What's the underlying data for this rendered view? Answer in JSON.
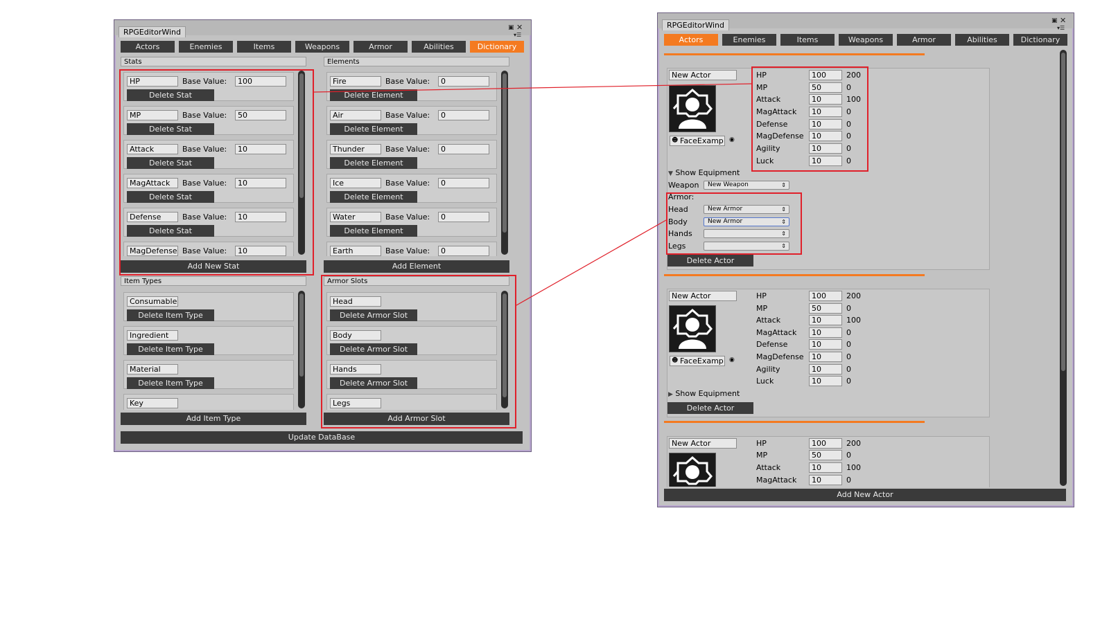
{
  "left": {
    "title": "RPGEditorWind",
    "tabs": [
      "Actors",
      "Enemies",
      "Items",
      "Weapons",
      "Armor",
      "Abilities",
      "Dictionary"
    ],
    "active_tab": "Dictionary",
    "stats": {
      "header": "Stats",
      "base_label": "Base Value:",
      "delete_label": "Delete Stat",
      "items": [
        {
          "name": "HP",
          "value": "100"
        },
        {
          "name": "MP",
          "value": "50"
        },
        {
          "name": "Attack",
          "value": "10"
        },
        {
          "name": "MagAttack",
          "value": "10"
        },
        {
          "name": "Defense",
          "value": "10"
        },
        {
          "name": "MagDefense",
          "value": "10"
        }
      ],
      "add_label": "Add New Stat"
    },
    "elements": {
      "header": "Elements",
      "base_label": "Base Value:",
      "delete_label": "Delete Element",
      "items": [
        {
          "name": "Fire",
          "value": "0"
        },
        {
          "name": "Air",
          "value": "0"
        },
        {
          "name": "Thunder",
          "value": "0"
        },
        {
          "name": "Ice",
          "value": "0"
        },
        {
          "name": "Water",
          "value": "0"
        },
        {
          "name": "Earth",
          "value": "0"
        }
      ],
      "add_label": "Add Element"
    },
    "item_types": {
      "header": "Item Types",
      "delete_label": "Delete Item Type",
      "items": [
        "Consumable",
        "Ingredient",
        "Material",
        "Key"
      ],
      "add_label": "Add Item Type"
    },
    "armor_slots": {
      "header": "Armor Slots",
      "delete_label": "Delete Armor Slot",
      "items": [
        "Head",
        "Body",
        "Hands",
        "Legs"
      ],
      "add_label": "Add Armor Slot"
    },
    "update_label": "Update DataBase"
  },
  "right": {
    "title": "RPGEditorWind",
    "tabs": [
      "Actors",
      "Enemies",
      "Items",
      "Weapons",
      "Armor",
      "Abilities",
      "Dictionary"
    ],
    "active_tab": "Actors",
    "actors": [
      {
        "name": "New Actor",
        "face": "FaceExamp",
        "stats": [
          {
            "name": "HP",
            "value": "100",
            "max": "200"
          },
          {
            "name": "MP",
            "value": "50",
            "max": "0"
          },
          {
            "name": "Attack",
            "value": "10",
            "max": "100"
          },
          {
            "name": "MagAttack",
            "value": "10",
            "max": "0"
          },
          {
            "name": "Defense",
            "value": "10",
            "max": "0"
          },
          {
            "name": "MagDefense",
            "value": "10",
            "max": "0"
          },
          {
            "name": "Agility",
            "value": "10",
            "max": "0"
          },
          {
            "name": "Luck",
            "value": "10",
            "max": "0"
          }
        ],
        "equipment_toggle": "Show Equipment",
        "weapon_label": "Weapon",
        "weapon_value": "New Weapon",
        "armor_label": "Armor:",
        "armor": [
          {
            "slot": "Head",
            "value": "New Armor"
          },
          {
            "slot": "Body",
            "value": "New Armor"
          },
          {
            "slot": "Hands",
            "value": ""
          },
          {
            "slot": "Legs",
            "value": ""
          }
        ],
        "delete_label": "Delete Actor"
      },
      {
        "name": "New Actor",
        "face": "FaceExamp",
        "stats": [
          {
            "name": "HP",
            "value": "100",
            "max": "200"
          },
          {
            "name": "MP",
            "value": "50",
            "max": "0"
          },
          {
            "name": "Attack",
            "value": "10",
            "max": "100"
          },
          {
            "name": "MagAttack",
            "value": "10",
            "max": "0"
          },
          {
            "name": "Defense",
            "value": "10",
            "max": "0"
          },
          {
            "name": "MagDefense",
            "value": "10",
            "max": "0"
          },
          {
            "name": "Agility",
            "value": "10",
            "max": "0"
          },
          {
            "name": "Luck",
            "value": "10",
            "max": "0"
          }
        ],
        "equipment_toggle": "Show Equipment",
        "delete_label": "Delete Actor"
      },
      {
        "name": "New Actor",
        "stats": [
          {
            "name": "HP",
            "value": "100",
            "max": "200"
          },
          {
            "name": "MP",
            "value": "50",
            "max": "0"
          },
          {
            "name": "Attack",
            "value": "10",
            "max": "100"
          },
          {
            "name": "MagAttack",
            "value": "10",
            "max": "0"
          }
        ]
      }
    ],
    "add_label": "Add New Actor"
  },
  "colors": {
    "accent": "#f47a20",
    "button": "#3c3c3c",
    "highlight": "#e0202a",
    "window_border": "#b9a7cf"
  }
}
